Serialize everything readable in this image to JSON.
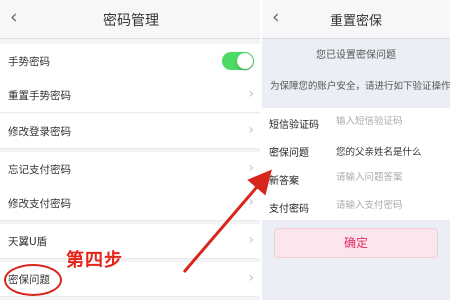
{
  "left_screen": {
    "title": "密码管理",
    "back_glyph": "‹",
    "rows": [
      {
        "label": "手势密码",
        "control": "toggle",
        "toggle_on": true
      },
      {
        "label": "重置手势密码"
      },
      {
        "label": "修改登录密码"
      },
      {
        "label": "忘记支付密码"
      },
      {
        "label": "修改支付密码"
      },
      {
        "label": "天翼U盾"
      },
      {
        "label": "密保问题"
      }
    ],
    "annotation": "第四步",
    "annotation_color": "#e62419",
    "toggle_color": "#4cd964"
  },
  "right_screen": {
    "title": "重置密保",
    "back_glyph": "‹",
    "hint": "您已设置密保问题",
    "description": "为保障您的账户安全，请进行如下验证操作",
    "fields": [
      {
        "label": "短信验证码",
        "placeholder": "输入短信验证码",
        "value": ""
      },
      {
        "label": "密保问题",
        "placeholder": "",
        "value": "您的父亲姓名是什么"
      },
      {
        "label": "新答案",
        "placeholder": "请输入问题答案",
        "value": ""
      },
      {
        "label": "支付密码",
        "placeholder": "请输入支付密码",
        "value": ""
      }
    ],
    "confirm_label": "确定",
    "confirm_color": "#e22b5f"
  },
  "arrow_color": "#d9261c",
  "chevron_glyph": "›"
}
